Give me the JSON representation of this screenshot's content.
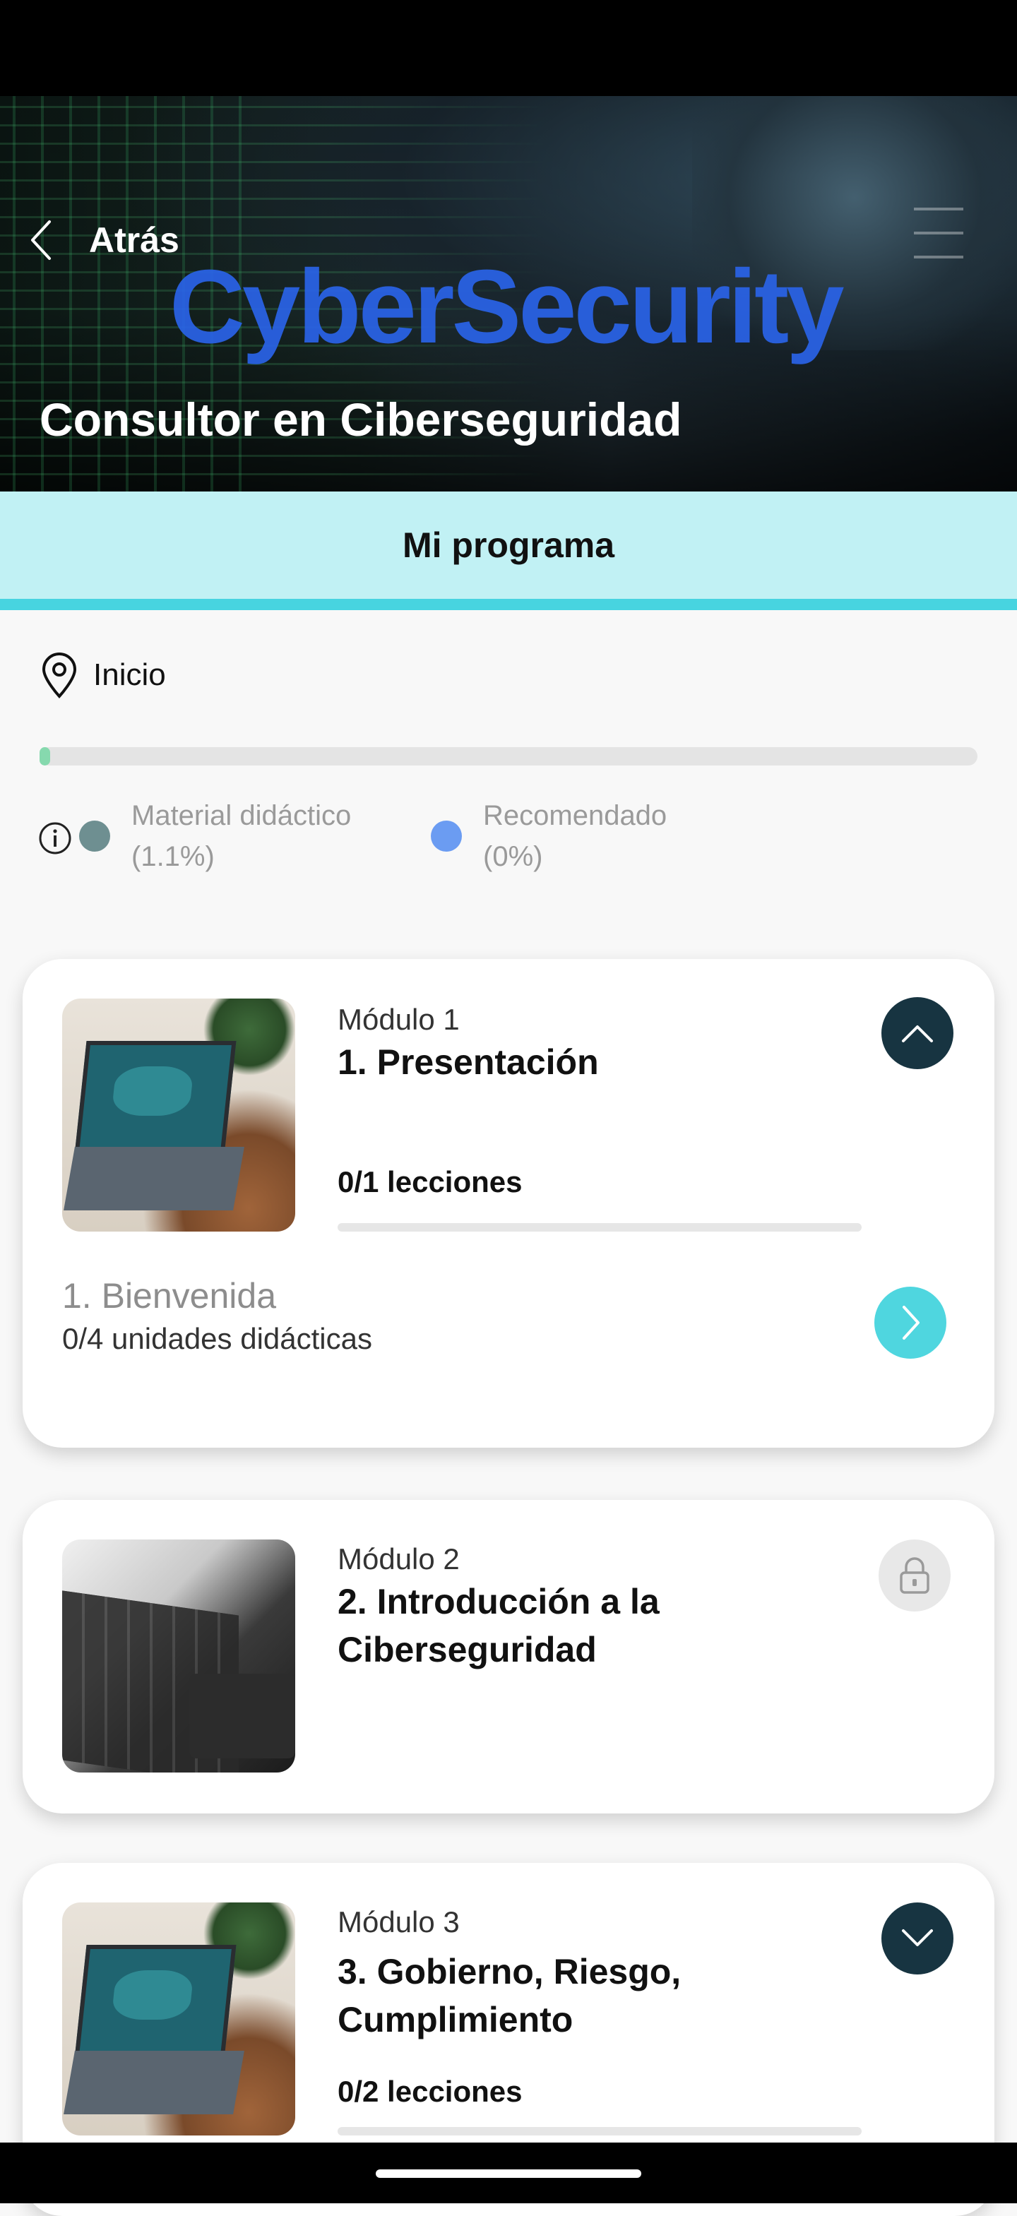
{
  "header": {
    "back_label": "Atrás",
    "banner_word": "CyberSecurity",
    "course_title": "Consultor en Ciberseguridad"
  },
  "tab": {
    "label": "Mi programa"
  },
  "progress": {
    "location_label": "Inicio",
    "value_percent": 1.1,
    "legend": [
      {
        "label": "Material didáctico",
        "value": "(1.1%)",
        "color": "#6e8f91"
      },
      {
        "label": "Recomendado",
        "value": "(0%)",
        "color": "#6b9cf2"
      }
    ]
  },
  "modules": [
    {
      "number": "Módulo 1",
      "title": "1. Presentación",
      "lessons": "0/1 lecciones",
      "state": "expanded",
      "units": [
        {
          "title": "1. Bienvenida",
          "subtitle": "0/4 unidades didácticas"
        }
      ]
    },
    {
      "number": "Módulo 2",
      "title": "2. Introducción a la Ciberseguridad",
      "state": "locked"
    },
    {
      "number": "Módulo 3",
      "title": "3. Gobierno, Riesgo, Cumplimiento",
      "lessons": "0/2 lecciones",
      "state": "collapsed"
    }
  ],
  "colors": {
    "accent_cyan": "#4fd6df",
    "tab_background": "#c1f1f4",
    "dark_button": "#173441"
  },
  "icons": {
    "back": "chevron-left-icon",
    "menu": "hamburger-menu-icon",
    "location": "location-pin-icon",
    "info": "info-icon",
    "collapse": "chevron-up-icon",
    "expand": "chevron-down-icon",
    "go": "chevron-right-icon",
    "lock": "lock-icon"
  }
}
